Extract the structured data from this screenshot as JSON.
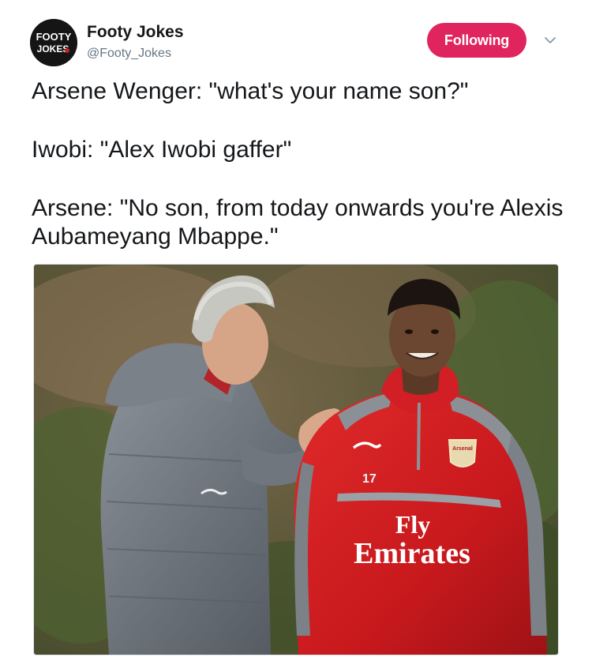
{
  "account": {
    "avatar": {
      "line1": "FOOTY",
      "line2": "JOKES",
      "icon": "footy-jokes-logo-icon"
    },
    "display_name": "Footy Jokes",
    "handle": "@Footy_Jokes"
  },
  "follow_button": {
    "label": "Following",
    "color": "#e0245e"
  },
  "menu": {
    "icon": "chevron-down-icon"
  },
  "tweet": {
    "lines": [
      "Arsene Wenger: \"what's your name son?\"",
      "Iwobi: \"Alex Iwobi gaffer\"",
      "Arsene: \"No son, from today onwards you're Alexis Aubameyang Mbappe.\""
    ]
  },
  "photo": {
    "jersey_number": "17",
    "sponsor_line1": "Fly",
    "sponsor_line2": "Emirates",
    "badge_text": "Arsenal"
  }
}
